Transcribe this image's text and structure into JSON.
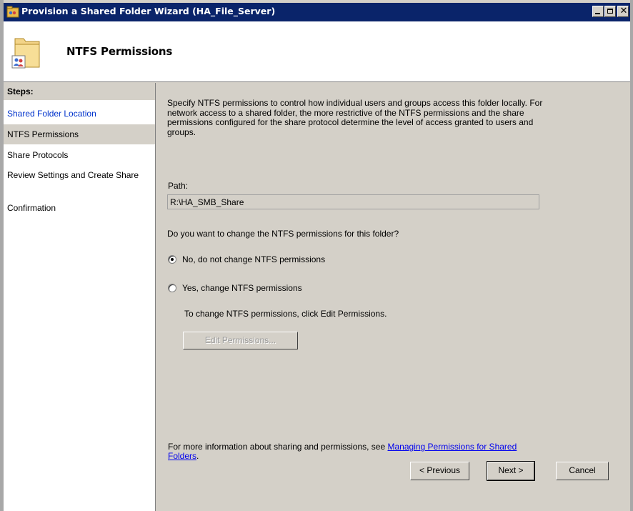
{
  "window": {
    "title": "Provision a Shared Folder Wizard (HA_File_Server)",
    "controls": {
      "minimize": "minimize",
      "maximize": "maximize",
      "close": "close"
    }
  },
  "header": {
    "title": "NTFS Permissions"
  },
  "steps": {
    "heading": "Steps:",
    "items": [
      {
        "label": "Shared Folder Location",
        "state": "link"
      },
      {
        "label": "NTFS Permissions",
        "state": "current"
      },
      {
        "label": "Share Protocols",
        "state": "normal"
      },
      {
        "label": "Review Settings and Create Share",
        "state": "normal"
      },
      {
        "label": "Confirmation",
        "state": "normal"
      }
    ]
  },
  "main": {
    "description": "Specify NTFS permissions to control how individual users and groups access this folder locally. For network access to a shared folder, the more restrictive of the NTFS permissions and the share permissions configured for the share protocol determine the level of access granted to users and groups.",
    "path_label": "Path:",
    "path_value": "R:\\HA_SMB_Share",
    "question": "Do you want to change the NTFS permissions for this folder?",
    "option_no": "No, do not change NTFS permissions",
    "option_yes": "Yes, change NTFS permissions",
    "selected_option": "no",
    "edit_info": "To change NTFS permissions, click Edit Permissions.",
    "edit_button": "Edit Permissions...",
    "footer_text": "For more information about sharing and permissions, see",
    "footer_link": "Managing Permissions for Shared Folders",
    "footer_end": "."
  },
  "buttons": {
    "previous": "< Previous",
    "next": "Next >",
    "cancel": "Cancel"
  },
  "colors": {
    "titlebar": "#0a246a",
    "link": "#0033cc",
    "face": "#d4d0c8"
  }
}
